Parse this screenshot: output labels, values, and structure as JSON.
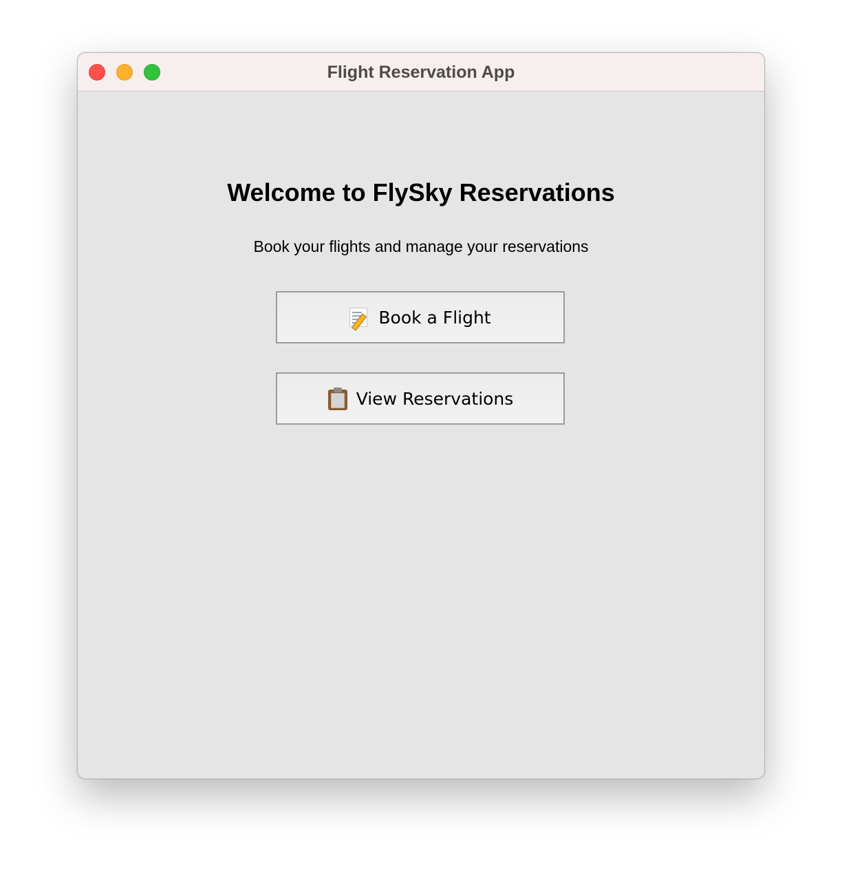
{
  "window": {
    "title": "Flight Reservation App"
  },
  "main": {
    "heading": "Welcome to FlySky Reservations",
    "subheading": "Book your flights and manage your reservations",
    "buttons": [
      {
        "label": "Book a Flight",
        "icon": "memo-icon"
      },
      {
        "label": "View Reservations",
        "icon": "clipboard-icon"
      }
    ]
  },
  "colors": {
    "titlebar_bg": "#f6efee",
    "window_bg": "#e6e5e5",
    "close": "#fe4f4a",
    "minimize": "#fdb02a",
    "zoom": "#32c33b"
  }
}
